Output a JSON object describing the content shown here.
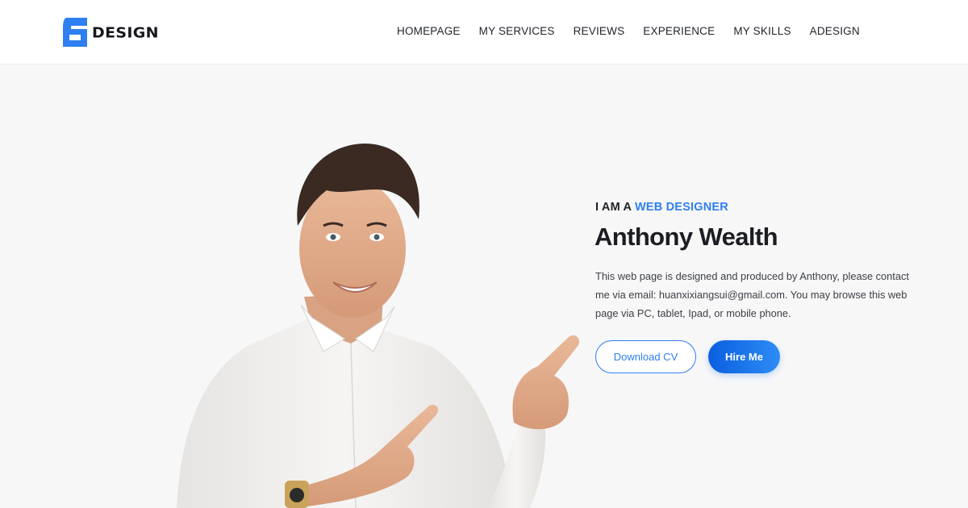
{
  "brand": {
    "name": "DESIGN",
    "color": "#2e7ff1"
  },
  "nav": {
    "items": [
      {
        "label": "HOMEPAGE"
      },
      {
        "label": "MY SERVICES"
      },
      {
        "label": "REVIEWS"
      },
      {
        "label": "EXPERIENCE"
      },
      {
        "label": "MY SKILLS"
      },
      {
        "label": "ADESIGN"
      }
    ]
  },
  "hero": {
    "eyebrow_prefix": "I AM A",
    "eyebrow_accent": "WEB DESIGNER",
    "name": "Anthony Wealth",
    "bio": "This web page is designed and produced by Anthony, please contact me via email: huanxixiangsui@gmail.com. You may browse this web page via PC, tablet, Ipad, or mobile phone.",
    "download_label": "Download CV",
    "hire_label": "Hire Me"
  },
  "colors": {
    "accent": "#2e7ff1",
    "text_dark": "#1b1d22",
    "background": "#f7f7f8"
  }
}
